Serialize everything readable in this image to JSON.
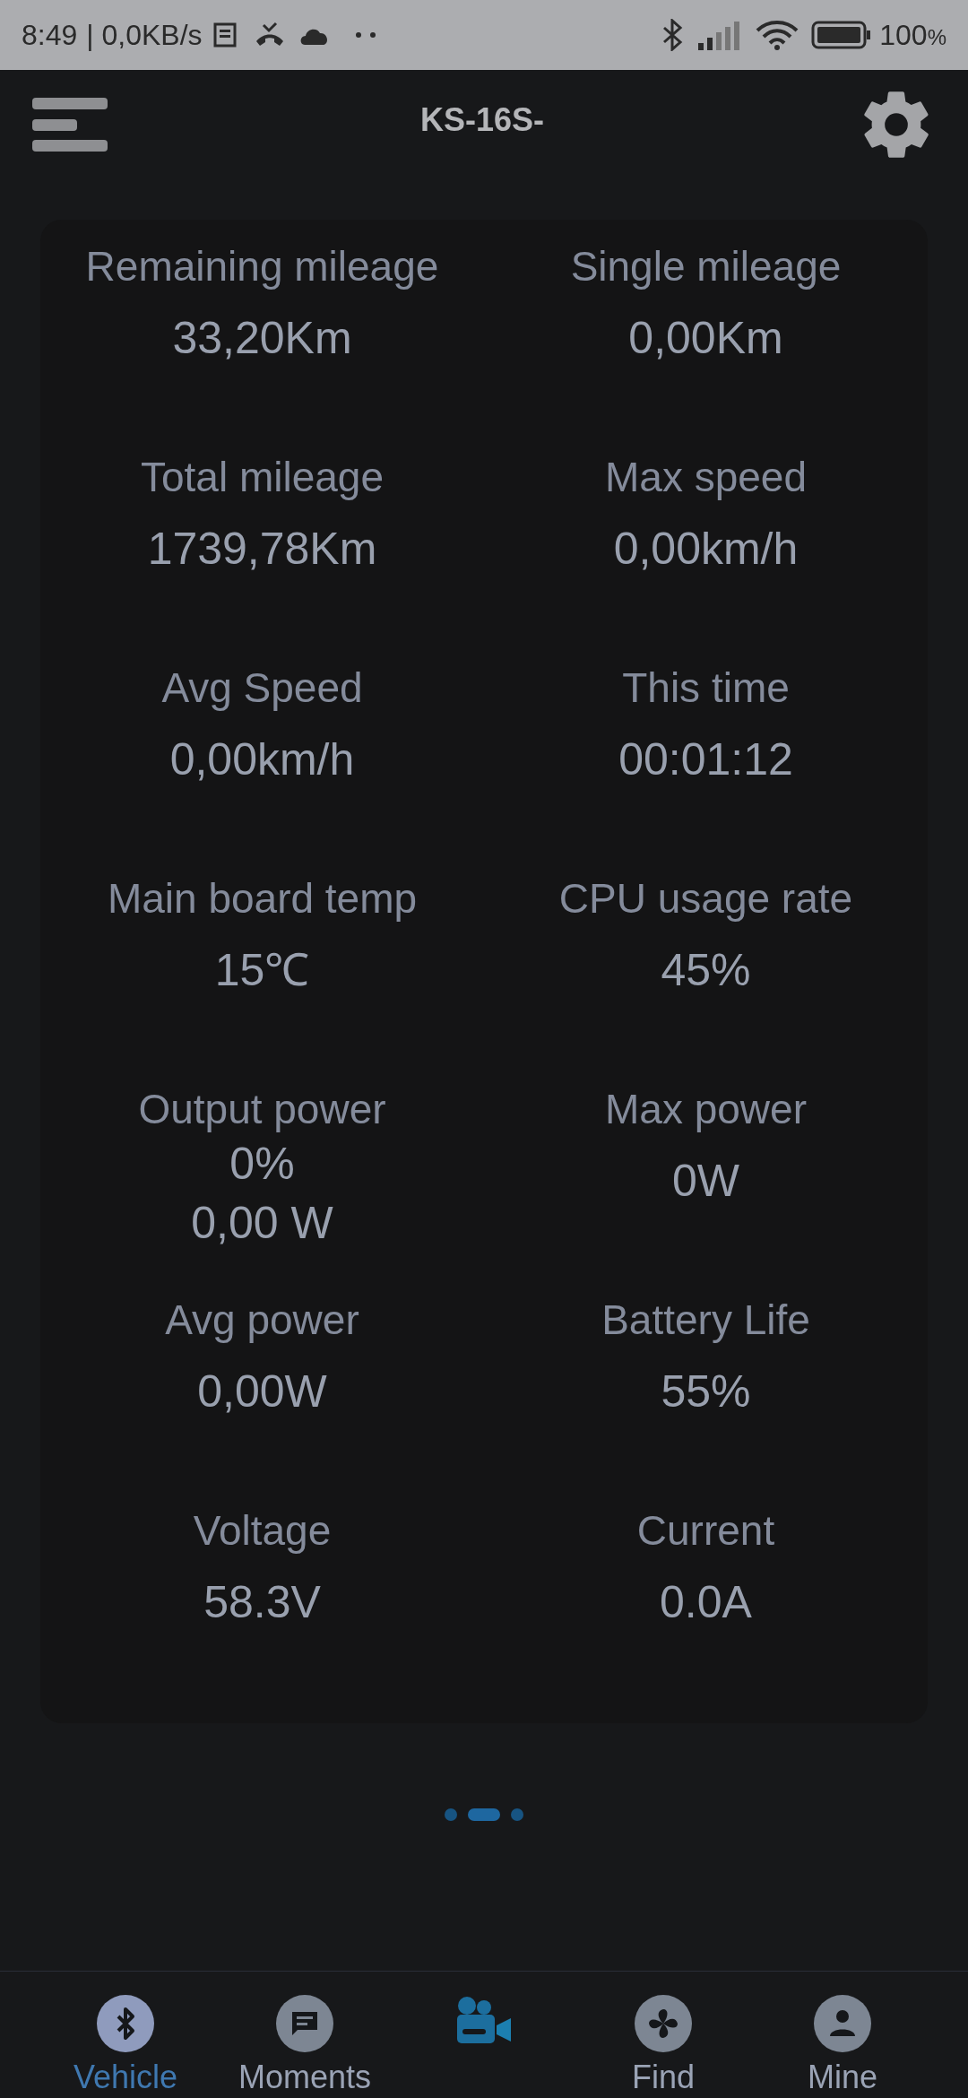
{
  "status_bar": {
    "time": "8:49",
    "speed": "| 0,0KB/s",
    "battery": "100",
    "battery_unit": "%"
  },
  "header": {
    "title": "KS-16S-"
  },
  "stats": [
    {
      "label": "Remaining mileage",
      "values": [
        "33,20Km"
      ]
    },
    {
      "label": "Single mileage",
      "values": [
        "0,00Km"
      ]
    },
    {
      "label": "Total mileage",
      "values": [
        "1739,78Km"
      ]
    },
    {
      "label": "Max speed",
      "values": [
        "0,00km/h"
      ]
    },
    {
      "label": "Avg Speed",
      "values": [
        "0,00km/h"
      ]
    },
    {
      "label": "This time",
      "values": [
        "00:01:12"
      ]
    },
    {
      "label": "Main board temp",
      "values": [
        "15℃"
      ]
    },
    {
      "label": "CPU usage rate",
      "values": [
        "45%"
      ]
    },
    {
      "label": "Output power",
      "values": [
        "0%",
        "0,00 W"
      ]
    },
    {
      "label": "Max power",
      "values": [
        "0W"
      ]
    },
    {
      "label": "Avg power",
      "values": [
        "0,00W"
      ]
    },
    {
      "label": "Battery Life",
      "values": [
        "55%"
      ]
    },
    {
      "label": "Voltage",
      "values": [
        "58.3V"
      ]
    },
    {
      "label": "Current",
      "values": [
        "0.0A"
      ]
    }
  ],
  "pager": [
    {
      "selected": false
    },
    {
      "selected": true
    },
    {
      "selected": false
    }
  ],
  "nav": [
    {
      "kind": "bluetooth",
      "label": "Vehicle",
      "selected": true
    },
    {
      "kind": "chat",
      "label": "Moments",
      "selected": false
    },
    {
      "kind": "camera",
      "selected": false
    },
    {
      "kind": "fan",
      "label": "Find",
      "selected": false
    },
    {
      "kind": "person",
      "label": "Mine",
      "selected": false
    }
  ]
}
